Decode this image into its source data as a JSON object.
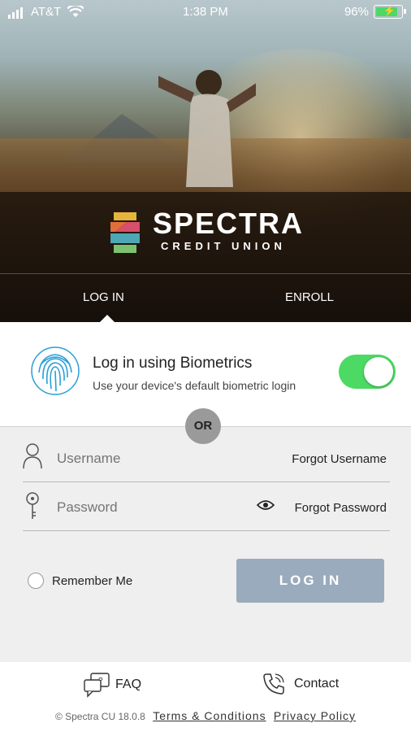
{
  "status_bar": {
    "carrier": "AT&T",
    "time": "1:38 PM",
    "battery": "96%"
  },
  "brand": {
    "name": "SPECTRA",
    "subtitle": "CREDIT UNION"
  },
  "tabs": [
    {
      "label": "LOG IN",
      "active": true
    },
    {
      "label": "ENROLL",
      "active": false
    }
  ],
  "biometrics": {
    "title": "Log in using Biometrics",
    "description": "Use your device's default biometric login",
    "enabled": true
  },
  "divider_label": "OR",
  "form": {
    "username_placeholder": "Username",
    "forgot_username": "Forgot Username",
    "password_placeholder": "Password",
    "forgot_password": "Forgot Password",
    "remember_me": "Remember Me",
    "login_button": "LOG IN"
  },
  "footer": {
    "faq": "FAQ",
    "contact": "Contact",
    "version": "© Spectra CU 18.0.8",
    "terms": "Terms & Conditions",
    "privacy": "Privacy Policy"
  },
  "colors": {
    "toggle_on": "#4cd964",
    "login_button": "#9aabbd",
    "fingerprint": "#2a9fd6"
  }
}
